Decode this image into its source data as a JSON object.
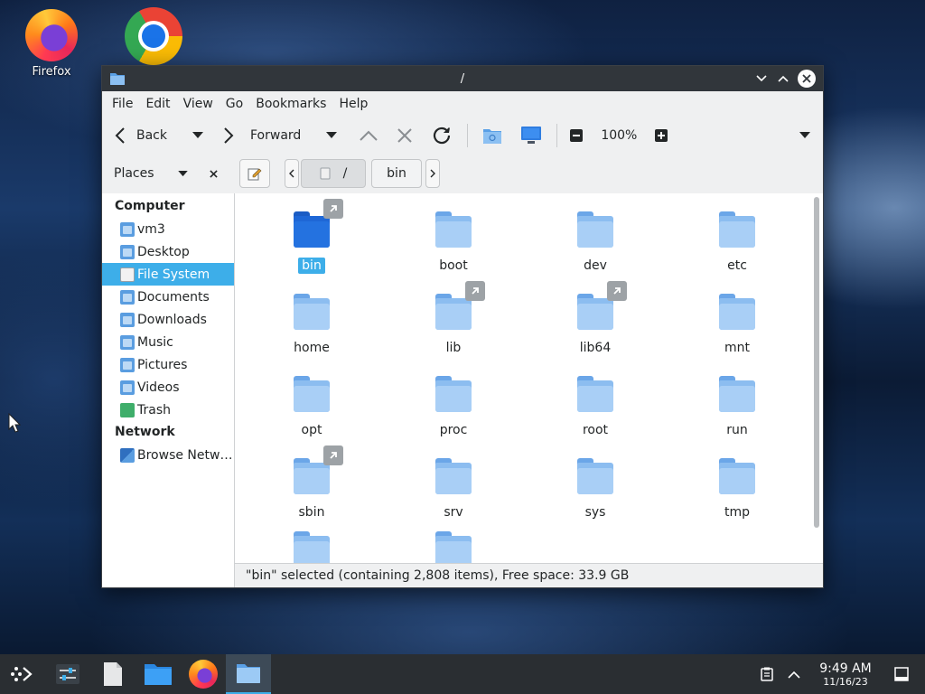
{
  "desktop": {
    "icons": [
      {
        "label": "Firefox"
      },
      {
        "label": ""
      }
    ]
  },
  "window": {
    "title": "/",
    "menu": [
      "File",
      "Edit",
      "View",
      "Go",
      "Bookmarks",
      "Help"
    ],
    "toolbar": {
      "back_label": "Back",
      "forward_label": "Forward",
      "zoom": "100%"
    },
    "places_label": "Places",
    "breadcrumb": [
      "/",
      "bin"
    ],
    "sidebar": {
      "computer_header": "Computer",
      "computer_items": [
        "vm3",
        "Desktop",
        "File System",
        "Documents",
        "Downloads",
        "Music",
        "Pictures",
        "Videos",
        "Trash"
      ],
      "selected": "File System",
      "network_header": "Network",
      "network_items": [
        "Browse Netw…"
      ]
    },
    "files": [
      {
        "name": "bin",
        "link": true,
        "selected": true
      },
      {
        "name": "boot",
        "link": false
      },
      {
        "name": "dev",
        "link": false
      },
      {
        "name": "etc",
        "link": false
      },
      {
        "name": "home",
        "link": false
      },
      {
        "name": "lib",
        "link": true
      },
      {
        "name": "lib64",
        "link": true
      },
      {
        "name": "mnt",
        "link": false
      },
      {
        "name": "opt",
        "link": false
      },
      {
        "name": "proc",
        "link": false
      },
      {
        "name": "root",
        "link": false
      },
      {
        "name": "run",
        "link": false
      },
      {
        "name": "sbin",
        "link": true
      },
      {
        "name": "srv",
        "link": false
      },
      {
        "name": "sys",
        "link": false
      },
      {
        "name": "tmp",
        "link": false
      },
      {
        "name": "",
        "link": false
      },
      {
        "name": "",
        "link": false
      }
    ],
    "status": "\"bin\" selected (containing 2,808 items), Free space: 33.9 GB"
  },
  "taskbar": {
    "time": "9:49 AM",
    "date": "11/16/23"
  },
  "colors": {
    "accent": "#3daee9",
    "titlebar": "#31363b",
    "taskbar": "#2a2e32"
  }
}
